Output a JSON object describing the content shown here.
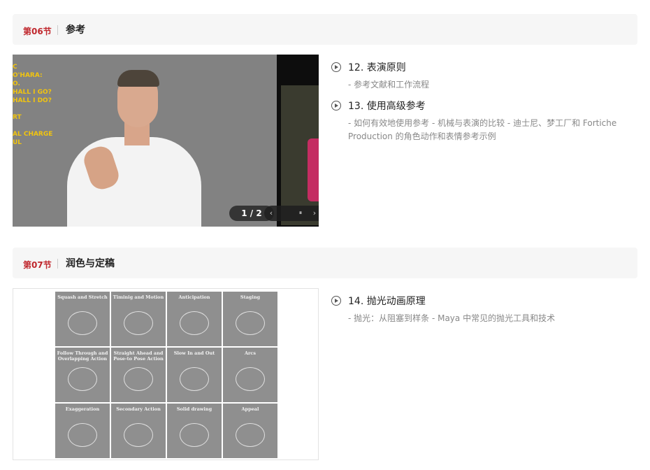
{
  "sections": [
    {
      "number": "第06节",
      "title": "参考",
      "slider": {
        "counter": "1 / 2",
        "overlay_lines": [
          "C",
          "O'HARA:",
          "O.",
          "HALL I GO?",
          "HALL I DO?",
          "",
          "RT",
          "",
          "AL CHARGE",
          "UL"
        ],
        "controls": {
          "prev_icon": "‹",
          "pause_icon": "⏸",
          "next_icon": "›"
        }
      },
      "lessons": [
        {
          "title": "12. 表演原则",
          "desc": "- 参考文献和工作流程"
        },
        {
          "title": "13. 使用高级参考",
          "desc": "- 如何有效地使用参考 - 机械与表演的比较 - 迪士尼、梦工厂和 Fortiche Production 的角色动作和表情参考示例"
        }
      ]
    },
    {
      "number": "第07节",
      "title": "润色与定稿",
      "principles": [
        "Squash and Stretch",
        "Timinig and Motion",
        "Anticipation",
        "Staging",
        "Follow Through and Overlapping Action",
        "Straight Ahead and Pose-to Pose Action",
        "Slow In and Out",
        "Arcs",
        "Exaggeration",
        "Secondary Action",
        "Solid drawing",
        "Appeal"
      ],
      "lessons": [
        {
          "title": "14. 抛光动画原理",
          "desc": "- 抛光：从阻塞到样条 - Maya 中常见的抛光工具和技术"
        }
      ]
    }
  ]
}
